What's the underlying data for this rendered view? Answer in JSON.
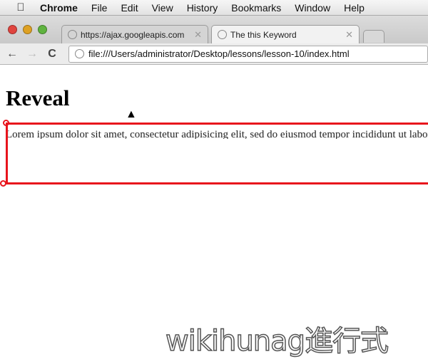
{
  "menubar": {
    "app": "Chrome",
    "items": [
      "File",
      "Edit",
      "View",
      "History",
      "Bookmarks",
      "Window",
      "Help"
    ]
  },
  "tabs": [
    {
      "title": "https://ajax.googleapis.com",
      "active": false
    },
    {
      "title": "The this Keyword",
      "active": true
    }
  ],
  "toolbar": {
    "url": "file:///Users/administrator/Desktop/lessons/lesson-10/index.html"
  },
  "page": {
    "heading": "Reveal",
    "paragraph": "Lorem ipsum dolor sit amet, consectetur adipisicing elit, sed do eiusmod tempor incididunt ut labore et dolore magna aliqua."
  },
  "colors": {
    "reveal_border": "#e8141c"
  },
  "watermark": "wikihunag進行式"
}
